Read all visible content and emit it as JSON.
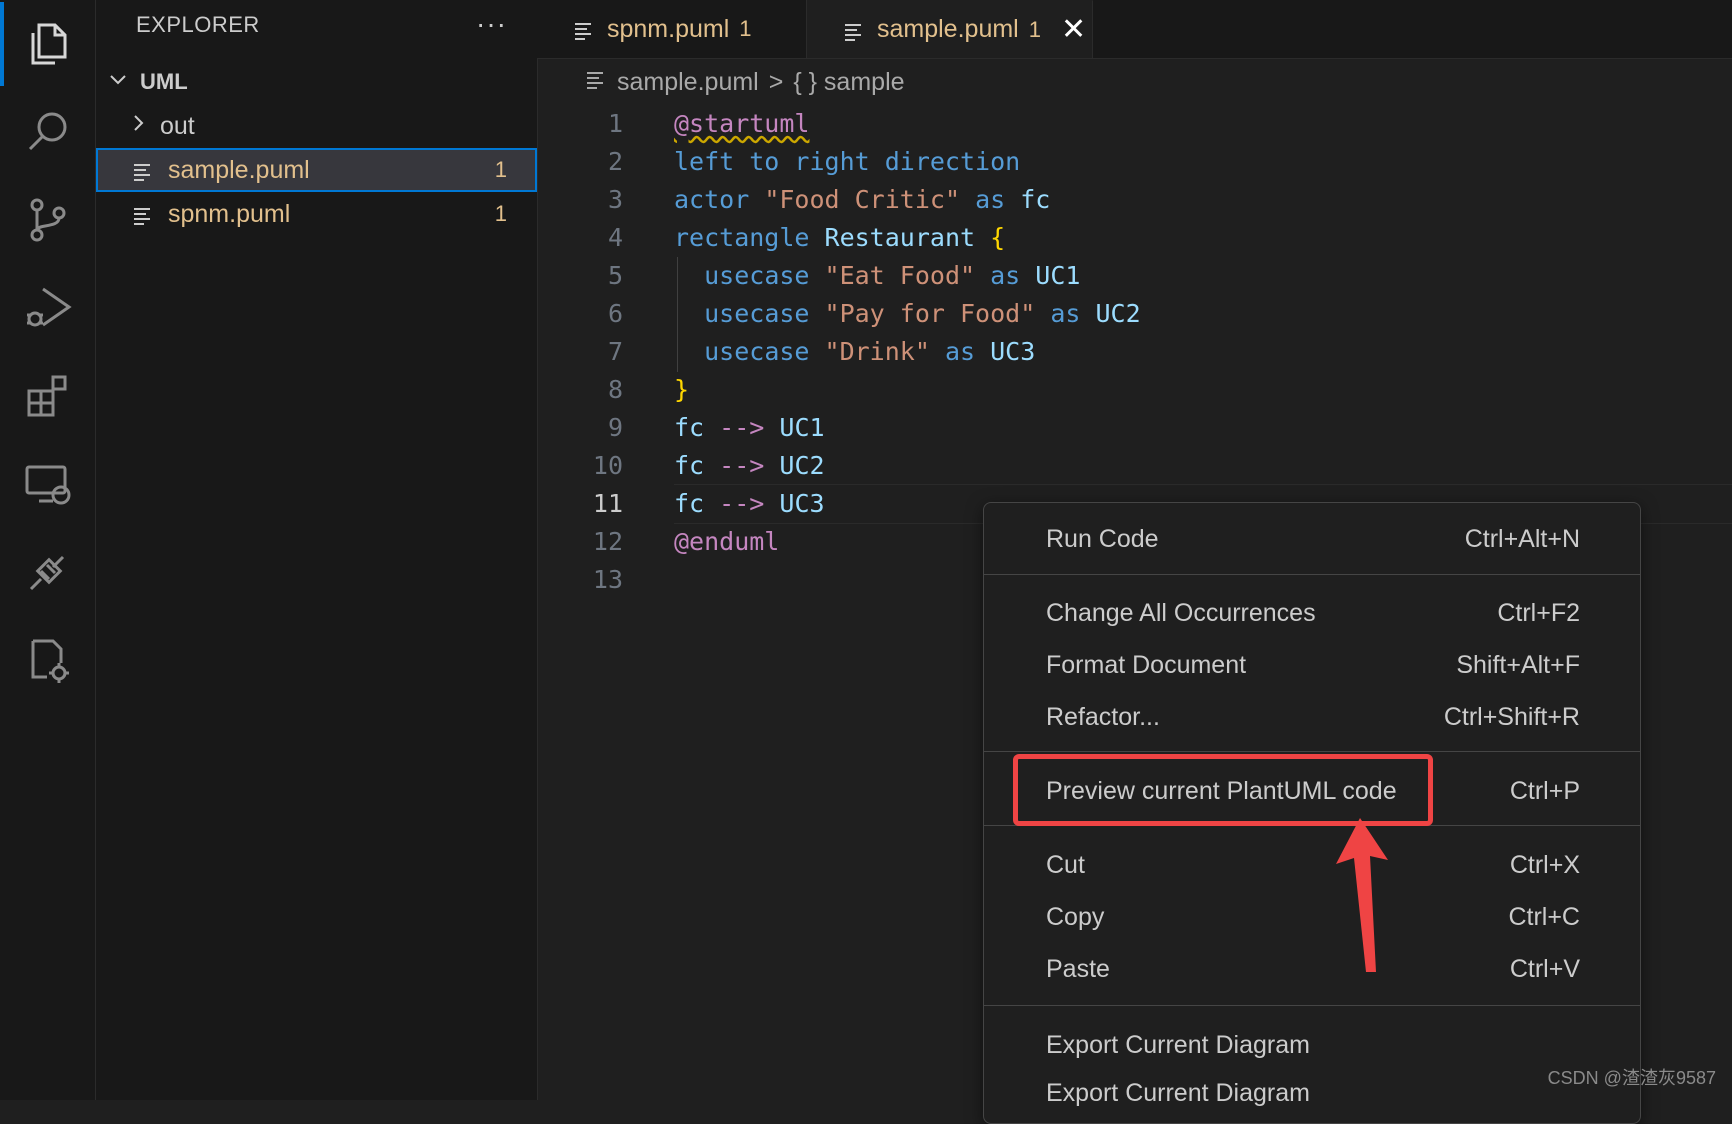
{
  "activity_bar": {
    "items": [
      {
        "name": "explorer-icon"
      },
      {
        "name": "search-icon"
      },
      {
        "name": "source-control-icon"
      },
      {
        "name": "run-debug-icon"
      },
      {
        "name": "extensions-icon"
      },
      {
        "name": "remote-explorer-icon"
      },
      {
        "name": "plug-icon"
      },
      {
        "name": "settings-file-icon"
      }
    ]
  },
  "sidebar": {
    "title": "EXPLORER",
    "more": "···",
    "folder": "UML",
    "items": [
      {
        "label": "out",
        "type": "folder"
      },
      {
        "label": "sample.puml",
        "badge": "1",
        "selected": true
      },
      {
        "label": "spnm.puml",
        "badge": "1"
      }
    ]
  },
  "tabs": [
    {
      "label": "spnm.puml",
      "badge": "1"
    },
    {
      "label": "sample.puml",
      "badge": "1",
      "close": "✕"
    }
  ],
  "breadcrumb": {
    "file": "sample.puml",
    "sep": ">",
    "symbol": "{ } sample"
  },
  "editor": {
    "line_numbers": [
      "1",
      "2",
      "3",
      "4",
      "5",
      "6",
      "7",
      "8",
      "9",
      "10",
      "11",
      "12",
      "13"
    ],
    "current_line": "11",
    "code": {
      "l1": "@startuml",
      "l2": "left to right direction",
      "l3_kw": "actor",
      "l3_str": "\"Food Critic\"",
      "l3_as": "as",
      "l3_id": "fc",
      "l4_kw": "rectangle",
      "l4_id": "Restaurant",
      "l4_brace": "{",
      "l5_kw": "usecase",
      "l5_str": "\"Eat Food\"",
      "l5_as": "as",
      "l5_id": "UC1",
      "l6_kw": "usecase",
      "l6_str": "\"Pay for Food\"",
      "l6_as": "as",
      "l6_id": "UC2",
      "l7_kw": "usecase",
      "l7_str": "\"Drink\"",
      "l7_as": "as",
      "l7_id": "UC3",
      "l8": "}",
      "l9_a": "fc",
      "l9_op": "-->",
      "l9_b": "UC1",
      "l10_a": "fc",
      "l10_op": "-->",
      "l10_b": "UC2",
      "l11_a": "fc",
      "l11_op": "-->",
      "l11_b": "UC3",
      "l12": "@enduml"
    }
  },
  "context_menu": {
    "items": [
      {
        "label": "Run Code",
        "key": "Ctrl+Alt+N"
      },
      {
        "label": "Change All Occurrences",
        "key": "Ctrl+F2"
      },
      {
        "label": "Format Document",
        "key": "Shift+Alt+F"
      },
      {
        "label": "Refactor...",
        "key": "Ctrl+Shift+R"
      },
      {
        "label": "Preview current PlantUML code",
        "key": "Ctrl+P"
      },
      {
        "label": "Cut",
        "key": "Ctrl+X"
      },
      {
        "label": "Copy",
        "key": "Ctrl+C"
      },
      {
        "label": "Paste",
        "key": "Ctrl+V"
      },
      {
        "label": "Export Current Diagram",
        "key": ""
      },
      {
        "label": "Export Current Diagram",
        "key": ""
      }
    ]
  },
  "annotation": {
    "color": "#ef4444"
  },
  "watermark": "CSDN @渣渣灰9587"
}
